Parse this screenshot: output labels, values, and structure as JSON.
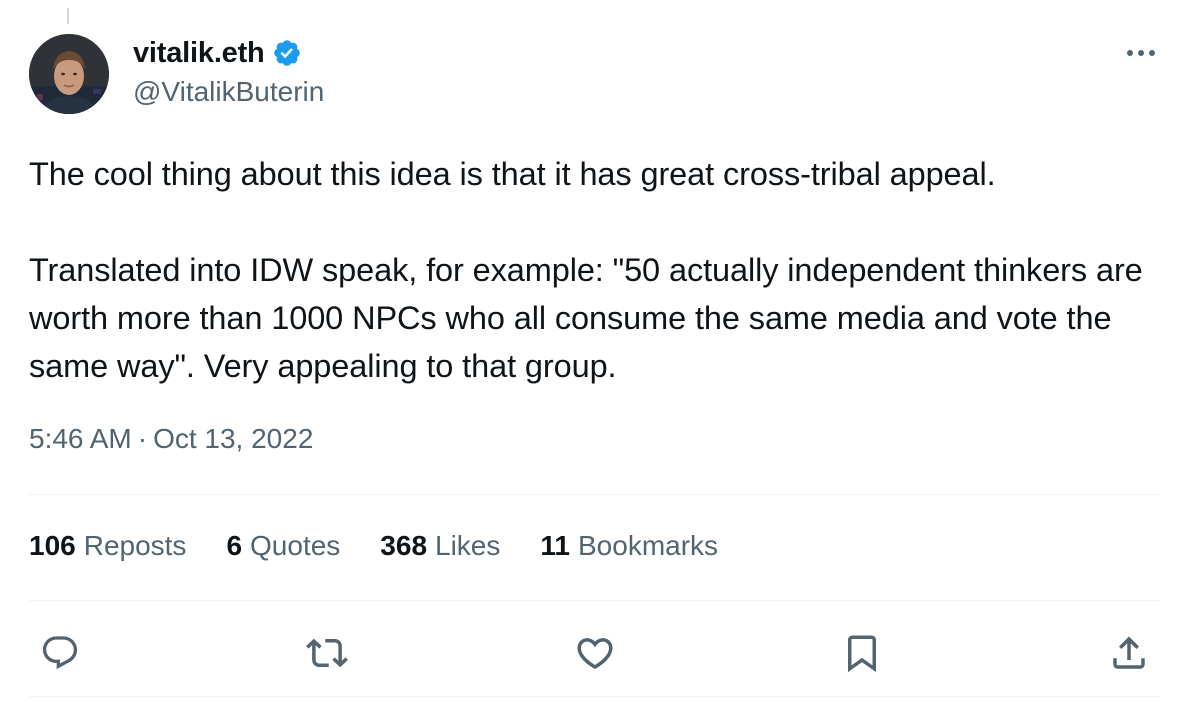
{
  "author": {
    "display_name": "vitalik.eth",
    "handle": "@VitalikButerin",
    "verified": true
  },
  "tweet": {
    "text": "The cool thing about this idea is that it has great cross-tribal appeal.\n\nTranslated into IDW speak, for example: \"50 actually independent thinkers are worth more than 1000 NPCs who all consume the same media and vote the same way\". Very appealing to that group.",
    "time": "5:46 AM",
    "separator": "·",
    "date": "Oct 13, 2022"
  },
  "stats": [
    {
      "count": "106",
      "label": "Reposts"
    },
    {
      "count": "6",
      "label": "Quotes"
    },
    {
      "count": "368",
      "label": "Likes"
    },
    {
      "count": "11",
      "label": "Bookmarks"
    }
  ],
  "actions": {
    "reply_icon": "reply-icon",
    "repost_icon": "repost-icon",
    "like_icon": "heart-icon",
    "bookmark_icon": "bookmark-icon",
    "share_icon": "share-icon"
  },
  "colors": {
    "text_primary": "#0f1419",
    "text_secondary": "#536471",
    "verified_blue": "#1d9bf0",
    "divider": "#eff3f4"
  }
}
